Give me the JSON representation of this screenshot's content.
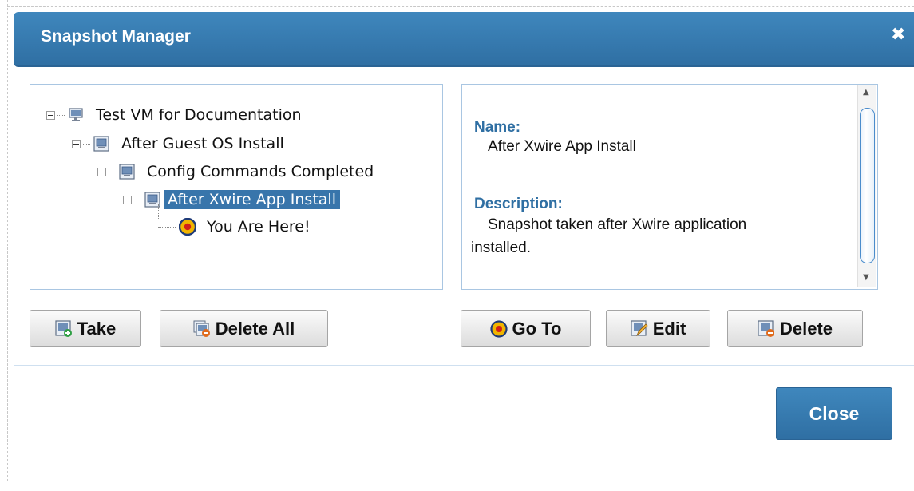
{
  "dialog": {
    "title": "Snapshot Manager",
    "close_icon": "close-icon",
    "accent": "#2f6fa3"
  },
  "tree": {
    "nodes": [
      {
        "label": "Test VM for Documentation",
        "icon": "vm-icon",
        "expanded": true
      },
      {
        "label": "After Guest OS Install",
        "icon": "snapshot-icon",
        "expanded": true
      },
      {
        "label": "Config Commands Completed",
        "icon": "snapshot-icon",
        "expanded": true
      },
      {
        "label": "After Xwire App Install",
        "icon": "snapshot-icon",
        "expanded": true,
        "selected": true
      },
      {
        "label": "You Are Here!",
        "icon": "current-location-icon"
      }
    ]
  },
  "details": {
    "name_heading": "Name:",
    "name_value": "After Xwire App Install",
    "description_heading": "Description:",
    "description_line1": "Snapshot taken after Xwire application",
    "description_line2": "installed."
  },
  "buttons": {
    "take": "Take",
    "delete_all": "Delete All",
    "go_to": "Go To",
    "edit": "Edit",
    "delete": "Delete",
    "close": "Close"
  }
}
